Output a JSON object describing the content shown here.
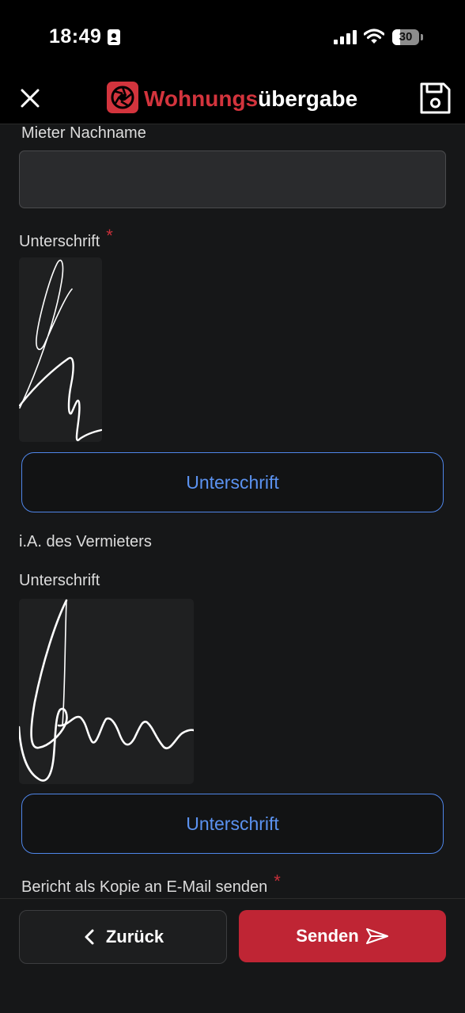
{
  "status_bar": {
    "time": "18:49",
    "battery_level": "30",
    "battery_fraction": 0.3
  },
  "header": {
    "close_icon": "close-icon",
    "logo_icon": "aperture-logo-icon",
    "logo_red": "Wohnungs",
    "logo_white": "übergabe",
    "save_icon": "floppy-disk-icon",
    "brand_color": "#d3343d"
  },
  "form": {
    "tenant_lastname_label": "Mieter Nachname",
    "tenant_lastname_value": "",
    "tenant_signature_label": "Unterschrift",
    "required_mark": "*",
    "tenant_signature_button": "Unterschrift",
    "landlord_section_label": "i.A. des Vermieters",
    "landlord_signature_label": "Unterschrift",
    "landlord_signature_button": "Unterschrift",
    "email_copy_label": "Bericht als Kopie an E-Mail senden",
    "accent_color": "#5b92f0"
  },
  "footer": {
    "back_label": "Zurück",
    "back_icon": "chevron-left-icon",
    "send_label": "Senden",
    "send_icon": "paper-plane-icon",
    "send_color": "#bf2534"
  }
}
